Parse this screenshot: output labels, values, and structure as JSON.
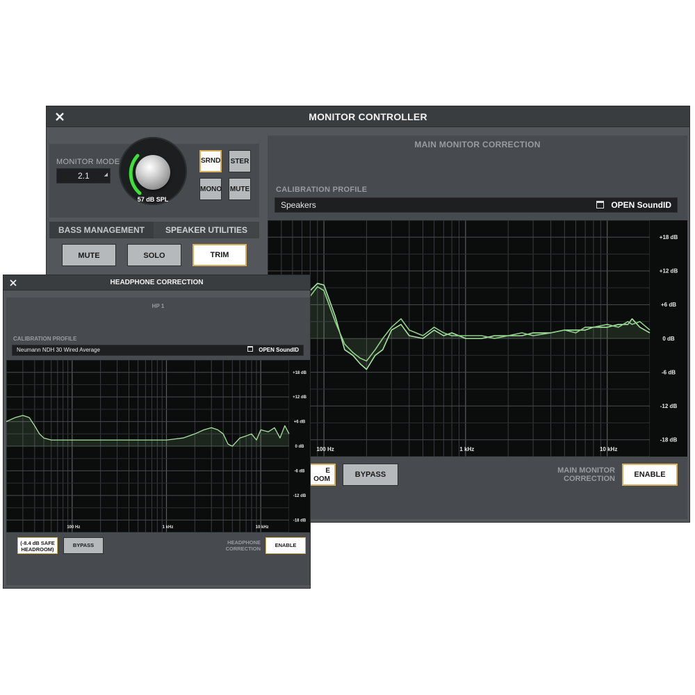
{
  "main_window": {
    "title": "MONITOR CONTROLLER",
    "close_icon": "close-icon",
    "monitor_mode": {
      "label": "MONITOR MODE",
      "value": "2.1"
    },
    "level_knob": {
      "readout": "57 dB SPL"
    },
    "mode_buttons": [
      {
        "label": "SRND",
        "active": true
      },
      {
        "label": "STER",
        "active": false
      },
      {
        "label": "MONO",
        "active": false
      },
      {
        "label": "MUTE",
        "active": false
      }
    ],
    "tabs": [
      {
        "label": "BASS MANAGEMENT",
        "active": true
      },
      {
        "label": "SPEAKER UTILITIES",
        "active": false
      }
    ],
    "utility_buttons": [
      {
        "label": "MUTE",
        "active": false
      },
      {
        "label": "SOLO",
        "active": false
      },
      {
        "label": "TRIM",
        "active": true
      }
    ],
    "correction_panel": {
      "title": "MAIN MONITOR CORRECTION",
      "calibration_label": "CALIBRATION PROFILE",
      "profile_name": "Speakers",
      "open_button": "OPEN SoundID",
      "headroom_button_partial": [
        "E",
        "OOM"
      ],
      "bypass_button": "BYPASS",
      "correction_label": [
        "MAIN MONITOR",
        "CORRECTION"
      ],
      "enable_button": "ENABLE"
    }
  },
  "headphone_window": {
    "title": "HEADPHONE CORRECTION",
    "close_icon": "close-icon",
    "output": "HP 1",
    "calibration_label": "CALIBRATION PROFILE",
    "profile_name": "Neumann NDH 30 Wired Average",
    "open_button": "OPEN SoundID",
    "headroom_button": [
      "(-8.4 dB SAFE",
      "HEADROOM)"
    ],
    "bypass_button": "BYPASS",
    "correction_label": [
      "HEADPHONE",
      "CORRECTION"
    ],
    "enable_button": "ENABLE"
  },
  "colors": {
    "curve": "#a6e3a0",
    "curve_dim": "#8fcf89",
    "knob_ring": "#3fe03a",
    "active_border": "#d9b05a"
  },
  "chart_data": [
    {
      "type": "line",
      "name": "main-monitor-response",
      "x_scale": "log",
      "xlim": [
        40,
        20000
      ],
      "ylim": [
        -21,
        21
      ],
      "x_tick_labels": [
        {
          "x": 100,
          "label": "100 Hz"
        },
        {
          "x": 1000,
          "label": "1 kHz"
        },
        {
          "x": 10000,
          "label": "10 kHz"
        }
      ],
      "y_tick_labels": [
        {
          "y": 18,
          "label": "+18 dB"
        },
        {
          "y": 12,
          "label": "+12 dB"
        },
        {
          "y": 6,
          "label": "+6 dB"
        },
        {
          "y": 0,
          "label": "0 dB"
        },
        {
          "y": -6,
          "label": "-6 dB"
        },
        {
          "y": -12,
          "label": "-12 dB"
        },
        {
          "y": -18,
          "label": "-18 dB"
        }
      ],
      "grid": true,
      "series": [
        {
          "x": [
            40,
            50,
            60,
            70,
            80,
            90,
            100,
            120,
            140,
            160,
            180,
            200,
            230,
            260,
            300,
            350,
            400,
            500,
            600,
            700,
            800,
            1000,
            1300,
            1600,
            2000,
            2500,
            3000,
            4000,
            5000,
            6000,
            7000,
            8000,
            10000,
            12000,
            14000,
            15000,
            17000,
            20000
          ],
          "y": [
            -3,
            0,
            3,
            6,
            8.5,
            9.8,
            9.5,
            4,
            -2,
            -3,
            -4.5,
            -5.5,
            -3,
            -2,
            1.5,
            2.5,
            0.5,
            0,
            1.5,
            0.5,
            1,
            0,
            0,
            0.5,
            0.5,
            0.5,
            1,
            1,
            1.5,
            1.5,
            1.5,
            2,
            2,
            2.5,
            2.5,
            3.5,
            2,
            1
          ]
        },
        {
          "x": [
            40,
            50,
            60,
            70,
            80,
            90,
            100,
            120,
            140,
            160,
            180,
            200,
            230,
            260,
            300,
            350,
            400,
            500,
            600,
            700,
            800,
            1000,
            1300,
            1600,
            2000,
            2500,
            3000,
            4000,
            5000,
            6000,
            7000,
            8000,
            10000,
            12000,
            14000,
            15000,
            17000,
            20000
          ],
          "y": [
            -2,
            0.5,
            3,
            5,
            7.5,
            9.2,
            8.5,
            3,
            -1,
            -2.5,
            -3.5,
            -4,
            -2,
            0,
            2,
            3.5,
            1.5,
            0.5,
            2,
            1,
            0.5,
            0.5,
            0.5,
            0,
            0.5,
            1,
            0.5,
            1,
            1.5,
            1,
            2,
            2,
            2.5,
            2,
            3,
            2.5,
            3,
            1.5
          ]
        }
      ]
    },
    {
      "type": "line",
      "name": "headphone-response",
      "x_scale": "log",
      "xlim": [
        20,
        20000
      ],
      "ylim": [
        -21,
        21
      ],
      "x_tick_labels": [
        {
          "x": 100,
          "label": "100 Hz"
        },
        {
          "x": 1000,
          "label": "1 kHz"
        },
        {
          "x": 10000,
          "label": "10 kHz"
        }
      ],
      "y_tick_labels": [
        {
          "y": 18,
          "label": "+18 dB"
        },
        {
          "y": 12,
          "label": "+12 dB"
        },
        {
          "y": 6,
          "label": "+6 dB"
        },
        {
          "y": 0,
          "label": "0 dB"
        },
        {
          "y": -6,
          "label": "-6 dB"
        },
        {
          "y": -12,
          "label": "-12 dB"
        },
        {
          "y": -18,
          "label": "-18 dB"
        }
      ],
      "grid": true,
      "series": [
        {
          "x": [
            20,
            25,
            30,
            35,
            40,
            45,
            50,
            60,
            70,
            80,
            100,
            150,
            200,
            300,
            500,
            700,
            1000,
            1500,
            2000,
            2500,
            3000,
            3500,
            4000,
            4500,
            5000,
            6000,
            7000,
            8000,
            9000,
            10000,
            12000,
            14000,
            16000,
            18000,
            20000
          ],
          "y": [
            6,
            7,
            7.5,
            7,
            5,
            3,
            2,
            1.5,
            1.5,
            1.5,
            1.5,
            1.5,
            1.5,
            1.5,
            1.5,
            1.5,
            1.5,
            2,
            3,
            4,
            4.5,
            4,
            3,
            0.5,
            0,
            2,
            2.5,
            3,
            1.5,
            4,
            3.5,
            4.5,
            2,
            5,
            3
          ]
        }
      ]
    }
  ]
}
